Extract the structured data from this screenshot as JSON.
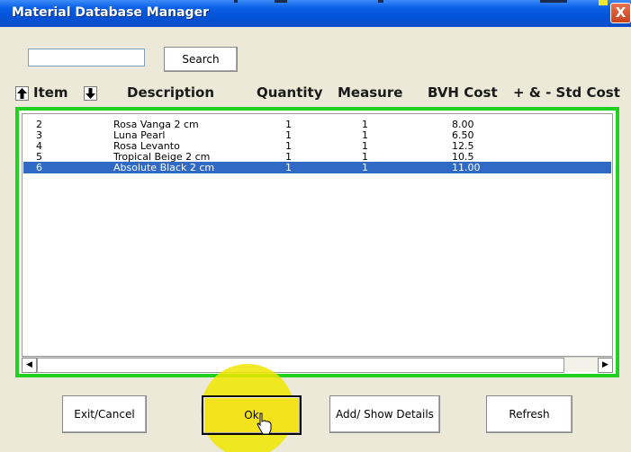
{
  "window": {
    "title": "Material Database Manager",
    "close_label": "X"
  },
  "search": {
    "value": "",
    "button_label": "Search"
  },
  "columns": {
    "up_arrow": "🠕",
    "item": "Item",
    "down_arrow": "🠗",
    "description": "Description",
    "quantity": "Quantity",
    "measure": "Measure",
    "bvh_cost": "BVH Cost",
    "std_cost": "+ & - Std Cost"
  },
  "rows": [
    {
      "item": "2",
      "description": "Rosa Vanga 2 cm",
      "quantity": "1",
      "measure": "1",
      "bvh_cost": "8.00",
      "selected": false
    },
    {
      "item": "3",
      "description": "Luna Pearl",
      "quantity": "1",
      "measure": "1",
      "bvh_cost": "6.50",
      "selected": false
    },
    {
      "item": "4",
      "description": "Rosa Levanto",
      "quantity": "1",
      "measure": "1",
      "bvh_cost": "12.5",
      "selected": false
    },
    {
      "item": "5",
      "description": "Tropical Beige 2 cm",
      "quantity": "1",
      "measure": "1",
      "bvh_cost": "10.5",
      "selected": false
    },
    {
      "item": "6",
      "description": "Absolute Black 2 cm",
      "quantity": "1",
      "measure": "1",
      "bvh_cost": "11.00",
      "selected": true
    }
  ],
  "scrollbar": {
    "left_arrow": "◀",
    "right_arrow": "▶"
  },
  "buttons": {
    "exit": "Exit/Cancel",
    "ok": "Ok",
    "add": "Add/ Show Details",
    "refresh": "Refresh"
  },
  "colors": {
    "title_bar": "#0454D9",
    "list_border": "#1FD21F",
    "selection": "#316AC5",
    "highlight": "#F0E600"
  }
}
